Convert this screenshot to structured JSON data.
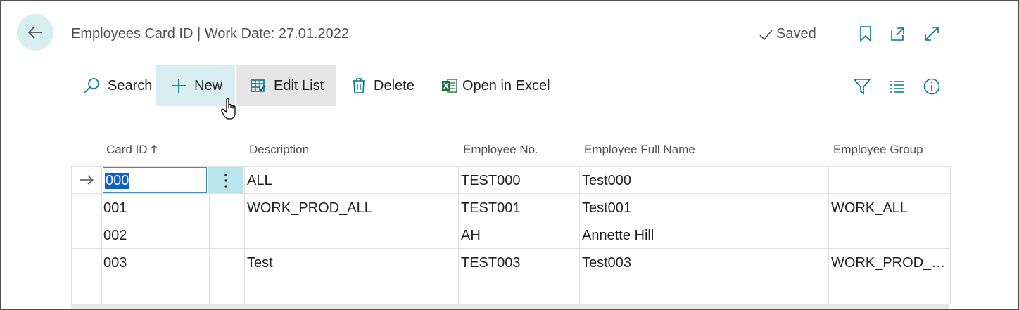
{
  "header": {
    "title": "Employees Card ID | Work Date: 27.01.2022",
    "status": "Saved"
  },
  "actions": {
    "search": "Search",
    "new": "New",
    "edit_list": "Edit List",
    "delete": "Delete",
    "open_in_excel": "Open in Excel"
  },
  "columns": {
    "card_id": "Card ID",
    "description": "Description",
    "employee_no": "Employee No.",
    "employee_full_name": "Employee Full Name",
    "employee_group": "Employee Group"
  },
  "rows": [
    {
      "card_id": "000",
      "description": "ALL",
      "employee_no": "TEST000",
      "employee_full_name": "Test000",
      "employee_group": ""
    },
    {
      "card_id": "001",
      "description": "WORK_PROD_ALL",
      "employee_no": "TEST001",
      "employee_full_name": "Test001",
      "employee_group": "WORK_ALL"
    },
    {
      "card_id": "002",
      "description": "",
      "employee_no": "AH",
      "employee_full_name": "Annette Hill",
      "employee_group": ""
    },
    {
      "card_id": "003",
      "description": "Test",
      "employee_no": "TEST003",
      "employee_full_name": "Test003",
      "employee_group": "WORK_PROD_A..."
    }
  ],
  "colors": {
    "accent": "#00778b",
    "new_bg": "#d8eef1",
    "selection": "#0f5fc8",
    "excel_green": "#1e7145"
  }
}
